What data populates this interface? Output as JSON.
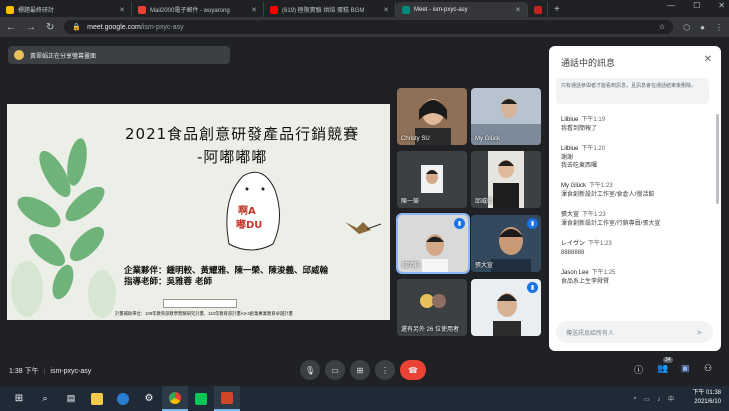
{
  "browser": {
    "tabs": [
      {
        "title": "標題最終研討",
        "color": "#fbbc04",
        "active": false
      },
      {
        "title": "Mail2000電子郵件 - wuyarong",
        "color": "#ea4335",
        "active": false
      },
      {
        "title": "(619) 極限實驗 烘焙 蛋糕 BGM",
        "color": "#ff0000",
        "active": false
      },
      {
        "title": "Meet - ism-pxyc-asy",
        "color": "#00897b",
        "active": true
      },
      {
        "title": "",
        "color": "#c5221f",
        "active": false
      }
    ],
    "new_tab": "+",
    "address": {
      "host": "meet.google.com",
      "path": "/ism-pxyc-asy"
    }
  },
  "meet": {
    "presenting_text": "黃翠娟正在分享螢幕畫面",
    "slide": {
      "title_line1": "2021食品創意研發產品行銷競賽",
      "title_line2": "-阿嘟嘟嘟",
      "mascot_line1": "啊A",
      "mascot_line2": "嘟DU",
      "members": "企業夥伴：鍾明較、黃耀雅、陳一榮、陳浚義、邱威翰",
      "advisor": "指導老師：吳雅蓉 老師",
      "footer": "計畫補助單位：109年教育部教學實驗研究計畫、110年教育部計畫A3-3創業專業教育卓越計畫"
    },
    "participants": [
      {
        "name": "Christy SU",
        "speaking": false
      },
      {
        "name": "My Glück",
        "speaking": false
      },
      {
        "name": "陳一榮",
        "speaking": false
      },
      {
        "name": "邱威翰",
        "speaking": false
      },
      {
        "name": "鍾明較",
        "speaking": true
      },
      {
        "name": "張大宣",
        "speaking": true
      },
      {
        "name": "還有另外 26 位使用者",
        "speaking": false
      },
      {
        "name": "",
        "speaking": true
      }
    ],
    "chat": {
      "title": "通話中的訊息",
      "notice": "只有通話參與者才能看到訊息，且訊息會在通話結束後刪除。",
      "messages": [
        {
          "sender": "Lilblue",
          "time": "下午1:19",
          "text": "我看到簡報了"
        },
        {
          "sender": "Lilblue",
          "time": "下午1:20",
          "text": "謝謝\n我去吃東西囉"
        },
        {
          "sender": "My Glück",
          "time": "下午1:23",
          "text": "渾食創新設計工作室/食倉人/慢活館"
        },
        {
          "sender": "張大宣",
          "time": "下午1:23",
          "text": "渾食創新設計工作室/行銷專員/張大宣"
        },
        {
          "sender": "レイヴン",
          "time": "下午1:23",
          "text": "8888888"
        },
        {
          "sender": "Jason Lee",
          "time": "下午1:25",
          "text": "食品系上生李舜賢"
        }
      ],
      "input_placeholder": "傳送訊息給所有人"
    },
    "bottom": {
      "time": "1:38 下午",
      "meeting_code": "ism-pxyc-asy",
      "people_count": "34"
    }
  },
  "taskbar": {
    "clock_time": "下午 01:38",
    "clock_date": "2021/6/10"
  }
}
